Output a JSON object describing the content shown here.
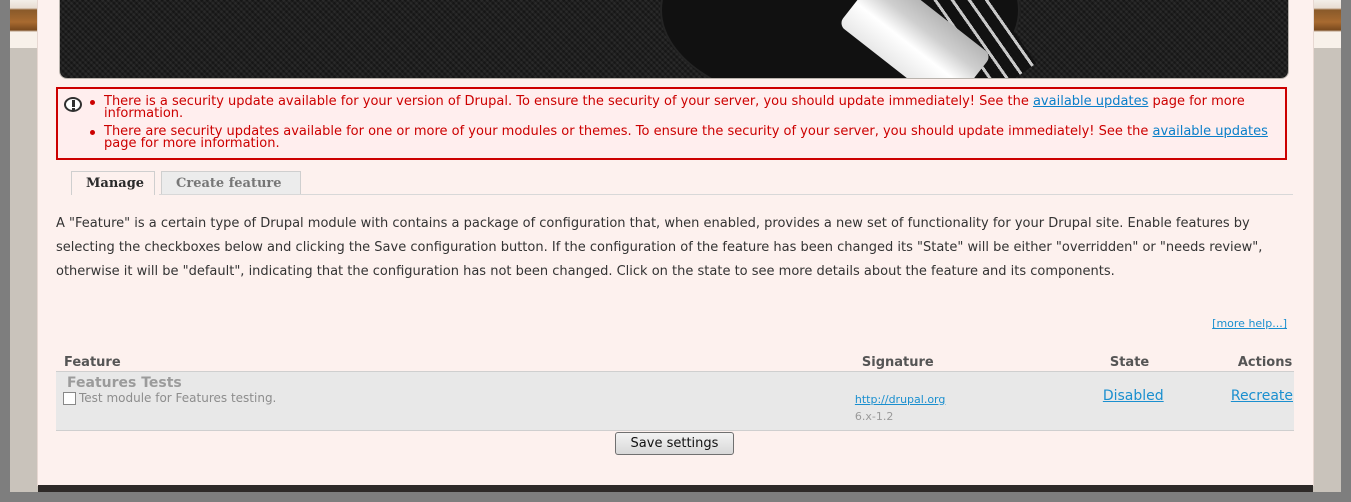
{
  "alerts": [
    {
      "text_1": "There is a security update available for your version of Drupal. To ensure the security of your server, you should update immediately! See the ",
      "link": "available updates",
      "text_2": " page for more information."
    },
    {
      "text_1": "There are security updates available for one or more of your modules or themes. To ensure the security of your server, you should update immediately! See the ",
      "link": "available updates",
      "text_2": " page for more information."
    }
  ],
  "tabs": [
    {
      "label": "Manage"
    },
    {
      "label": "Create feature"
    }
  ],
  "description": "A \"Feature\" is a certain type of Drupal module with contains a package of configuration that, when enabled, provides a new set of functionality for your Drupal site. Enable features by selecting the checkboxes below and clicking the Save configuration button. If the configuration of the feature has been changed its \"State\" will be either \"overridden\" or \"needs review\", otherwise it will be \"default\", indicating that the configuration has not been changed. Click on the state to see more details about the feature and its components.",
  "more_help": "[more help...]",
  "table": {
    "columns": [
      "Feature",
      "Signature",
      "State",
      "Actions"
    ],
    "rows": [
      {
        "name": "Features Tests",
        "description": "Test module for Features testing.",
        "signature_url": "http://drupal.org",
        "version": "6.x-1.2",
        "state": "Disabled",
        "action": "Recreate"
      }
    ]
  },
  "save_button": "Save settings",
  "colors": {
    "alert_border": "#cc0000",
    "alert_bg": "#ffeeee",
    "link": "#1a8fcf",
    "page_bg": "#fdf1ee"
  }
}
